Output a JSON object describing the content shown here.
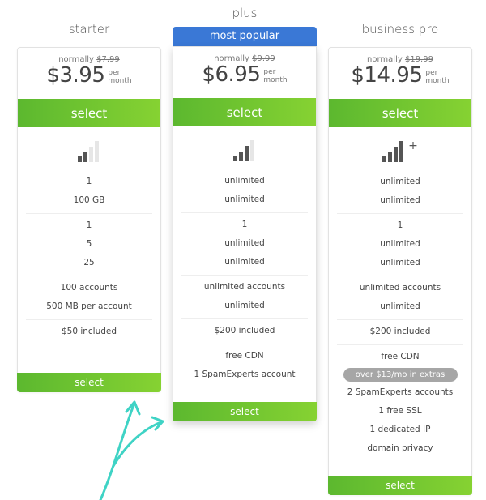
{
  "colors": {
    "accent_green": "#6cc52f",
    "badge_blue": "#3a78d6",
    "arrow": "#3fd3c5"
  },
  "plans": [
    {
      "name": "starter",
      "normally_label": "normally",
      "old_price": "$7.99",
      "price": "$3.95",
      "per": "per",
      "month": "month",
      "select_label": "select",
      "signal_level": 2,
      "signal_plus": false,
      "groups": [
        [
          "1",
          "100 GB"
        ],
        [
          "1",
          "5",
          "25"
        ],
        [
          "100 accounts",
          "500 MB per account"
        ],
        [
          "$50 included"
        ]
      ]
    },
    {
      "name": "plus",
      "badge": "most popular",
      "normally_label": "normally",
      "old_price": "$9.99",
      "price": "$6.95",
      "per": "per",
      "month": "month",
      "select_label": "select",
      "signal_level": 3,
      "signal_plus": false,
      "groups": [
        [
          "unlimited",
          "unlimited"
        ],
        [
          "1",
          "unlimited",
          "unlimited"
        ],
        [
          "unlimited accounts",
          "unlimited"
        ],
        [
          "$200 included"
        ],
        [
          "free CDN",
          "1 SpamExperts account"
        ]
      ]
    },
    {
      "name": "business pro",
      "normally_label": "normally",
      "old_price": "$19.99",
      "price": "$14.95",
      "per": "per",
      "month": "month",
      "select_label": "select",
      "signal_level": 4,
      "signal_plus": true,
      "signal_plus_label": "+",
      "groups": [
        [
          "unlimited",
          "unlimited"
        ],
        [
          "1",
          "unlimited",
          "unlimited"
        ],
        [
          "unlimited accounts",
          "unlimited"
        ],
        [
          "$200 included"
        ]
      ],
      "extras_pill": "over $13/mo in extras",
      "last_group": [
        "free CDN",
        "2 SpamExperts accounts",
        "1 free SSL",
        "1 dedicated IP",
        "domain privacy"
      ]
    }
  ]
}
